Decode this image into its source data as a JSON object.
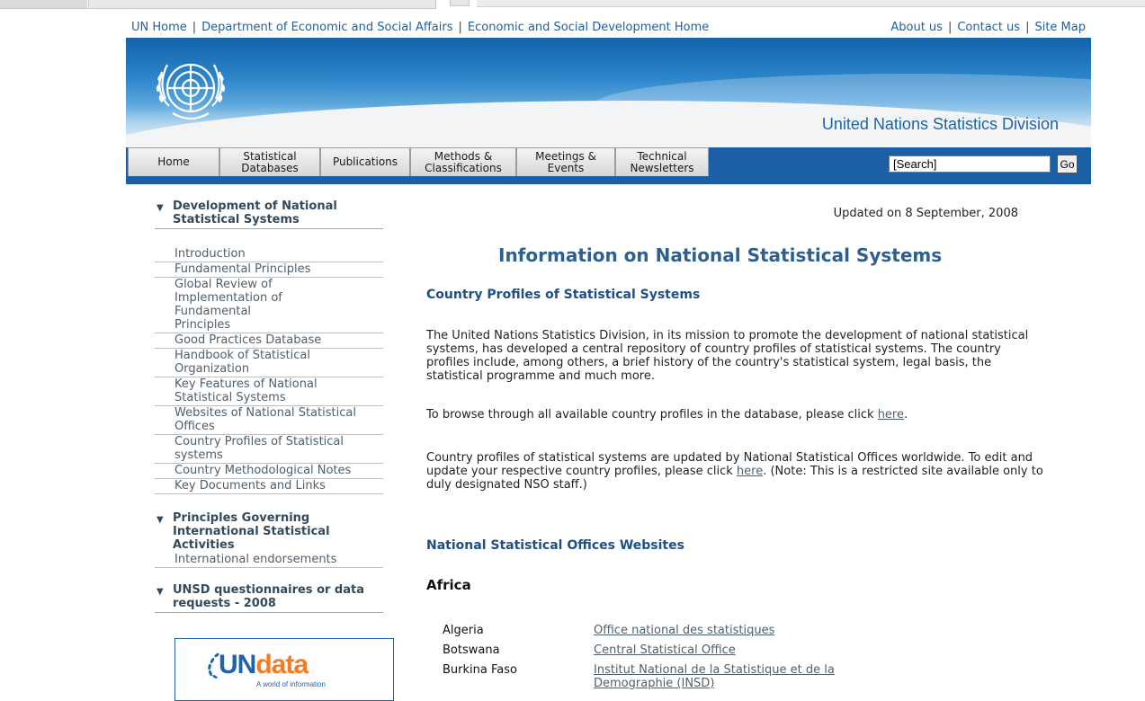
{
  "topnav": {
    "left_links": [
      "UN Home",
      "Department of Economic and Social Affairs",
      "Economic and Social Development Home"
    ],
    "right_links": [
      "About us",
      "Contact us",
      "Site Map"
    ]
  },
  "banner": {
    "title": "United Nations Statistics Division"
  },
  "menu": {
    "tabs": [
      "Home",
      "Statistical Databases",
      "Publications",
      "Methods & Classifications",
      "Meetings & Events",
      "Technical Newsletters"
    ],
    "search_value": "[Search]",
    "go_label": "Go"
  },
  "sidebar": {
    "section1": {
      "title": "Development of National Statistical Systems",
      "items": [
        "Introduction",
        "Fundamental Principles",
        "Global Review of Implementation of Fundamental Principles",
        "Good Practices Database",
        "Handbook of Statistical Organization",
        "Key Features of National Statistical Systems",
        "Websites of National Statistical Offices",
        "Country Profiles of Statistical systems",
        "Country Methodological Notes",
        "Key Documents and Links"
      ]
    },
    "section2": {
      "title": "Principles Governing International Statistical Activities",
      "items": [
        "International endorsements"
      ]
    },
    "section3": {
      "title": "UNSD questionnaires or data requests - 2008"
    },
    "undata": {
      "logo_un": "UN",
      "logo_data": "data",
      "tagline": "A world of information"
    }
  },
  "main": {
    "updated": "Updated on 8 September, 2008",
    "title": "Information on National Statistical Systems",
    "country_profiles_head": "Country Profiles of Statistical Systems",
    "para1": "The United Nations Statistics Division, in its mission to promote the development of national statistical systems, has developed a central repository of country profiles of statistical systems. The country profiles include, among others, a brief history of the country's statistical system, legal basis, the statistical programme and much more.",
    "para2_prefix": "To browse through all available country profiles in the database, please click ",
    "para2_link": "here",
    "para2_suffix": ".",
    "para3_prefix": "Country profiles of statistical systems are updated by National Statistical Offices worldwide. To edit and update your respective country profiles, please click ",
    "para3_link": "here",
    "para3_suffix": ". (Note: This is a restricted site available only to duly designated NSO staff.)",
    "nso_head": "National Statistical Offices Websites",
    "africa_head": "Africa",
    "countries": [
      {
        "name": "Algeria",
        "office": "Office national des statistiques"
      },
      {
        "name": "Botswana",
        "office": "Central Statistical Office"
      },
      {
        "name": "Burkina Faso",
        "office": "Institut National de la Statistique et de la Demographie (INSD)"
      }
    ]
  }
}
